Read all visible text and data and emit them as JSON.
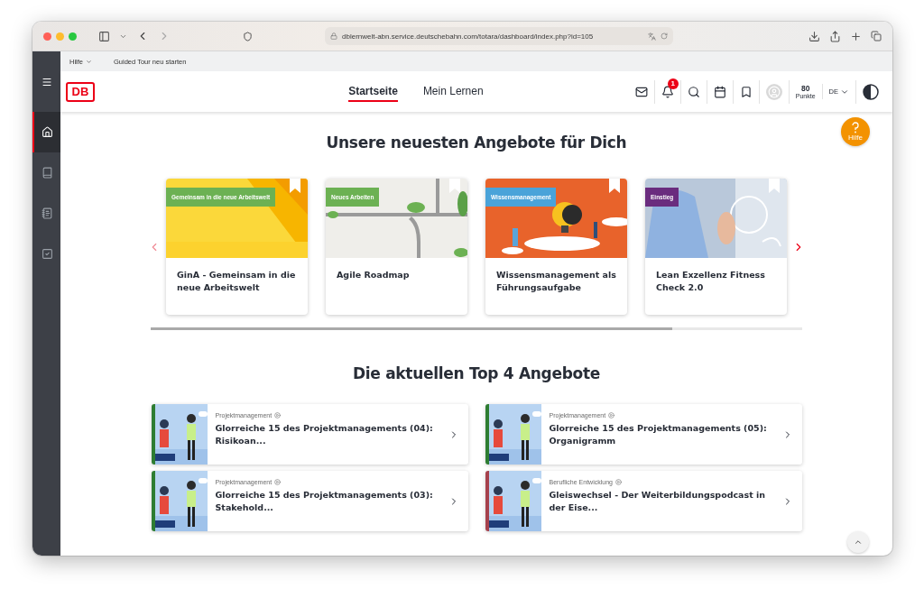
{
  "browser": {
    "url": "dblernwelt-abn.service.deutschebahn.com/totara/dashboard/index.php?id=105"
  },
  "sidebar": {
    "items": [
      {
        "kind": "home",
        "selected": true
      },
      {
        "kind": "book",
        "selected": false
      },
      {
        "kind": "notes",
        "selected": false
      },
      {
        "kind": "check",
        "selected": false
      }
    ]
  },
  "top_links": [
    {
      "label": "Hilfe",
      "dropdown": true
    },
    {
      "label": "Guided Tour neu starten",
      "dropdown": false
    }
  ],
  "logo": "DB",
  "nav": [
    {
      "label": "Startseite",
      "selected": true
    },
    {
      "label": "Mein Lernen",
      "selected": false
    }
  ],
  "notifications": {
    "count": "1"
  },
  "points": {
    "value": "80",
    "label": "Punkte"
  },
  "language": "DE",
  "help_button": "Hilfe",
  "featured": {
    "title": "Unsere neuesten Angebote für Dich",
    "cards": [
      {
        "tag": "Gemeinsam in die neue Arbeitswelt",
        "color": "#6cb153",
        "title": "GinA - Gemeinsam in die neue Arbeitswelt"
      },
      {
        "tag": "Neues Arbeiten",
        "color": "#6cb153",
        "title": "Agile Roadmap"
      },
      {
        "tag": "Wissensmanagement",
        "color": "#4aa3d9",
        "title": "Wissensmanagement als Führungsaufgabe"
      },
      {
        "tag": "Einstieg",
        "color": "#6a2c7e",
        "title": "Lean Exzellenz Fitness Check 2.0"
      }
    ]
  },
  "top4": {
    "title": "Die aktuellen Top 4 Angebote",
    "items": [
      {
        "category": "Projektmanagement",
        "title": "Glorreiche 15 des Projektmanagements (04): Risikoan...",
        "color": "#2e7d32"
      },
      {
        "category": "Projektmanagement",
        "title": "Glorreiche 15 des Projektmanagements (05): Organigramm",
        "color": "#2e7d32"
      },
      {
        "category": "Projektmanagement",
        "title": "Glorreiche 15 des Projektmanagements (03): Stakehold...",
        "color": "#2e7d32"
      },
      {
        "category": "Berufliche Entwicklung",
        "title": "Gleiswechsel - Der Weiterbildungspodcast in der Eise...",
        "color": "#a6424d"
      }
    ]
  }
}
